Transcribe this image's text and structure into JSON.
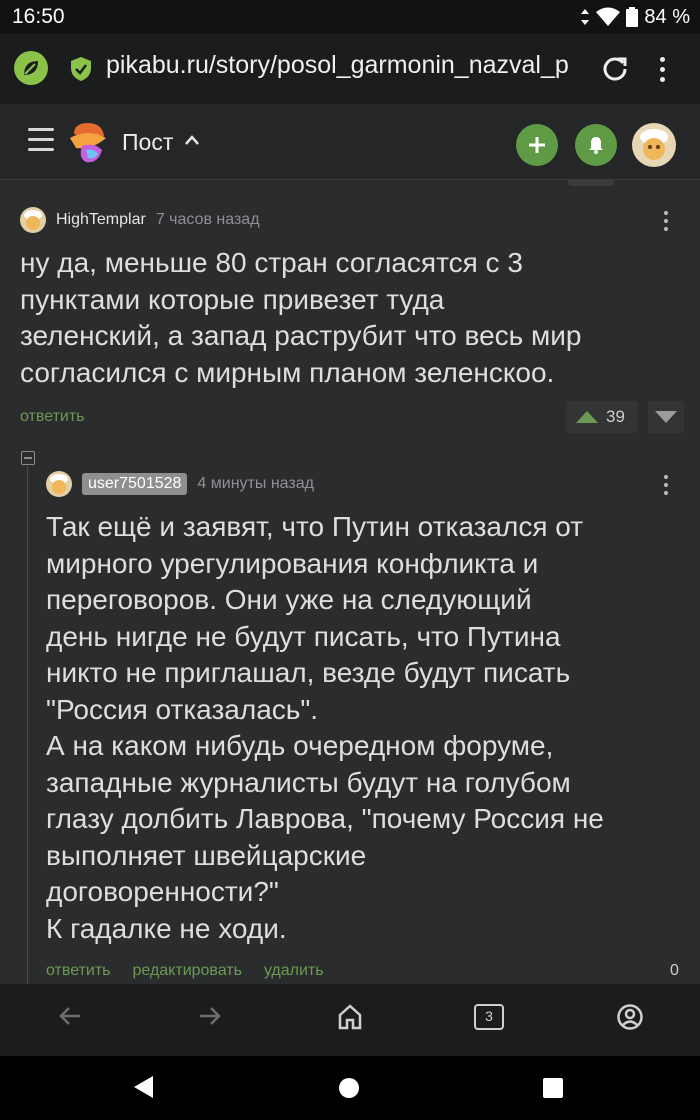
{
  "status_bar": {
    "time": "16:50",
    "battery": "84 %"
  },
  "browser": {
    "url": "pikabu.ru/story/posol_garmonin_nazval_p"
  },
  "header": {
    "section_label": "Пост"
  },
  "comments": [
    {
      "author": "HighTemplar",
      "time": "7 часов назад",
      "text": "ну да, меньше 80 стран согласятся с 3\nпунктами которые привезет туда\nзеленский, а запад раструбит что весь мир\nсогласился с мирным планом зеленскоо.",
      "reply_label": "ответить",
      "rating": "39"
    },
    {
      "author": "user7501528",
      "time": "4 минуты назад",
      "text": "Так ещё и заявят, что Путин отказался от\nмирного урегулирования конфликта и\nпереговоров. Они уже на следующий\nдень нигде не будут писать, что Путина\nникто не приглашал, везде будут писать\n\"Россия отказалась\".\nА на каком нибудь очередном форуме,\nзападные журналисты будут на голубом\nглазу долбить Лаврова, \"почему Россия не\nвыполняет швейцарские\nдоговоренности?\"\nК гадалке не ходи.",
      "reply_label": "ответить",
      "edit_label": "редактировать",
      "delete_label": "удалить",
      "rating": "0"
    }
  ],
  "toolbar": {
    "tabs_count": "3"
  },
  "colors": {
    "accent_green": "#6c9a52",
    "button_green": "#5f9b45",
    "background": "#2b2c2e"
  }
}
